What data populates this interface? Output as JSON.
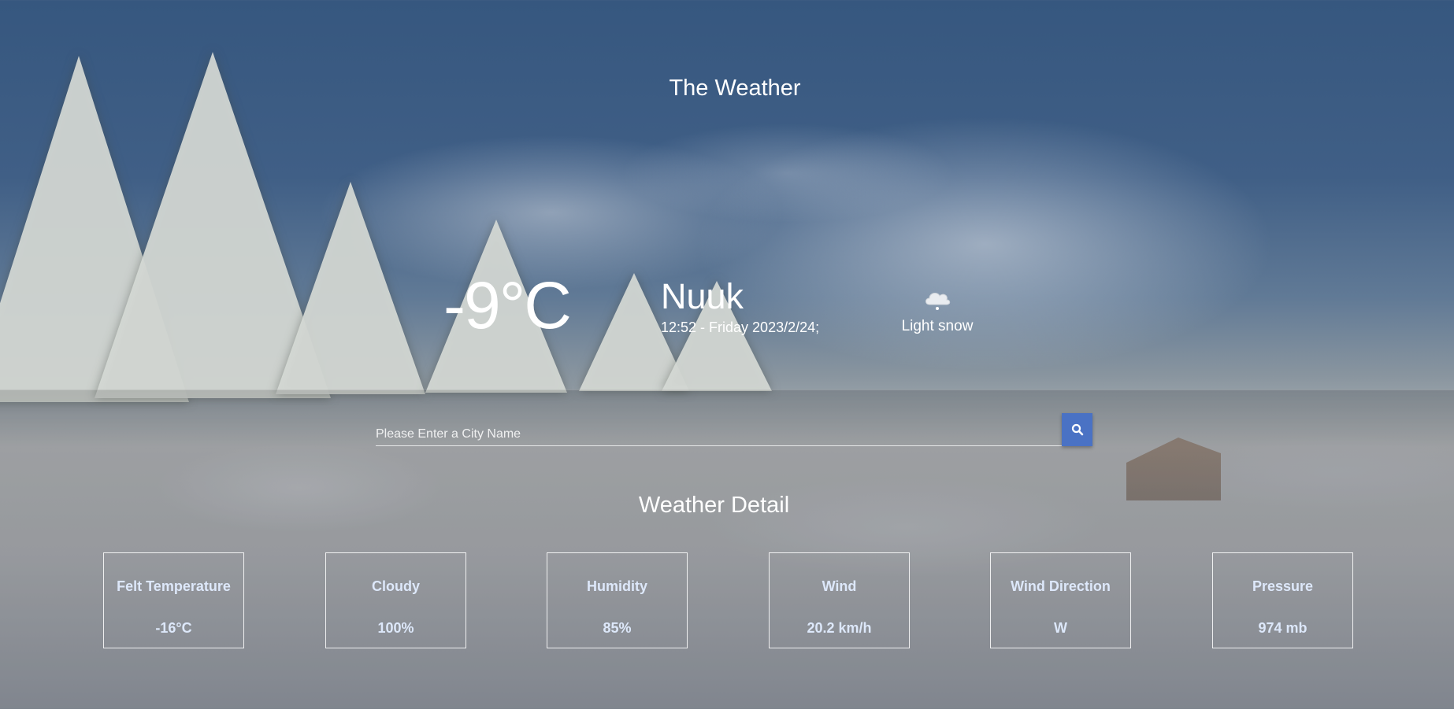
{
  "app": {
    "title": "The Weather"
  },
  "current": {
    "temperature": "-9°C",
    "city": "Nuuk",
    "datetime": "12:52 - Friday 2023/2/24;",
    "condition": "Light snow",
    "condition_icon": "light-snow-cloud-icon"
  },
  "search": {
    "placeholder": "Please Enter a City Name",
    "value": "",
    "button_icon": "search-icon"
  },
  "details": {
    "title": "Weather Detail",
    "items": [
      {
        "label": "Felt Temperature",
        "value": "-16°C"
      },
      {
        "label": "Cloudy",
        "value": "100%"
      },
      {
        "label": "Humidity",
        "value": "85%"
      },
      {
        "label": "Wind",
        "value": "20.2 km/h"
      },
      {
        "label": "Wind Direction",
        "value": "W"
      },
      {
        "label": "Pressure",
        "value": "974 mb"
      }
    ]
  },
  "colors": {
    "accent": "#4a72c4",
    "card_text": "#dde8fa",
    "text": "#ffffff"
  }
}
